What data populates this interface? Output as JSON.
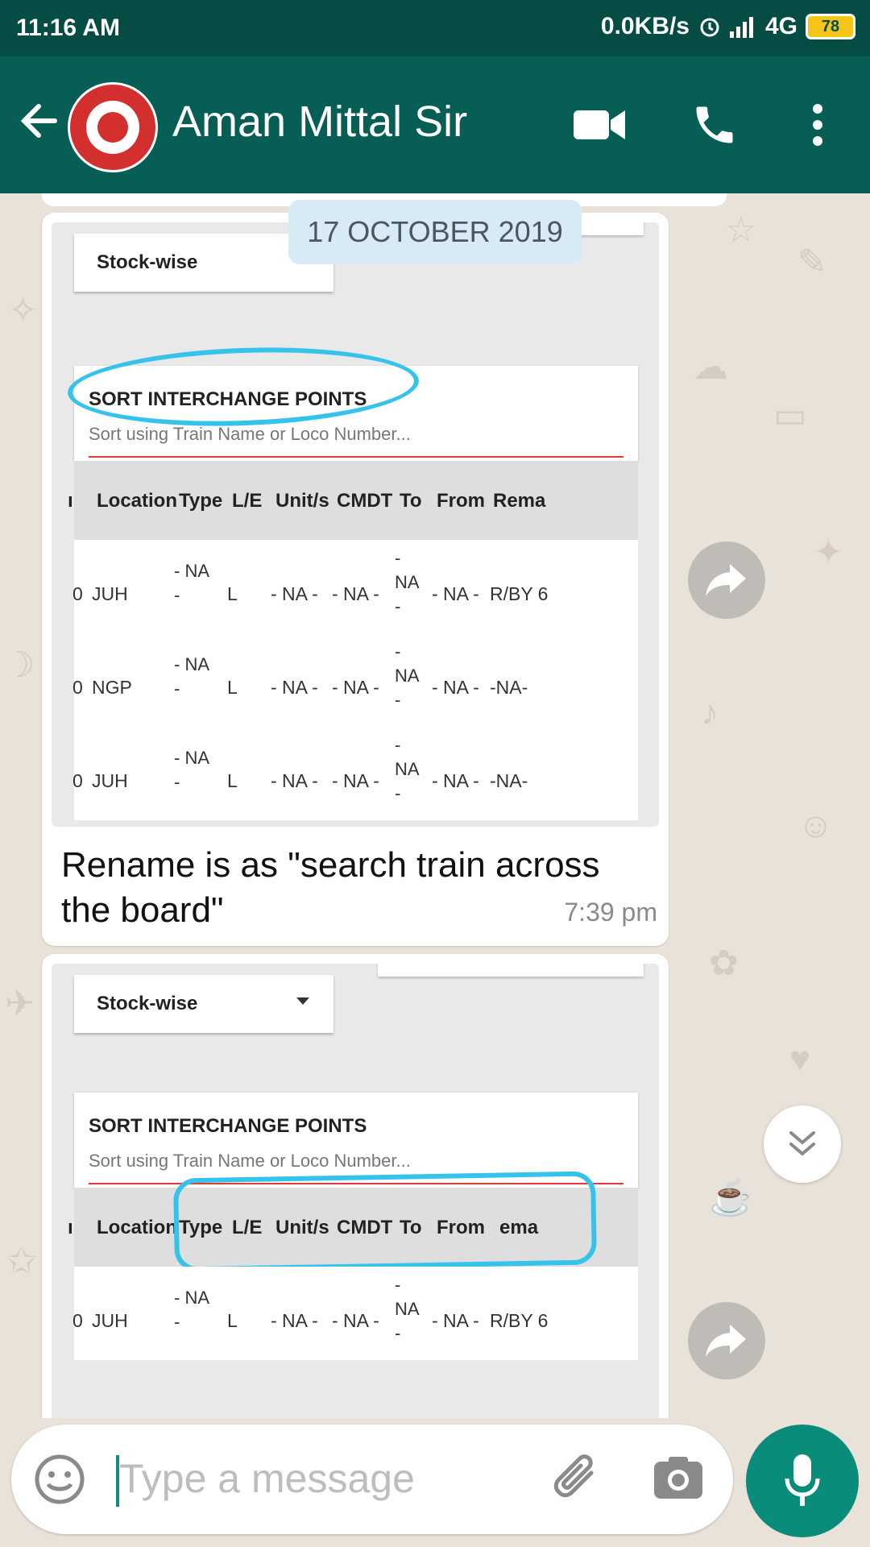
{
  "status_bar": {
    "time": "11:16 AM",
    "net_speed": "0.0KB/s",
    "network": "4G",
    "battery": "78"
  },
  "app_bar": {
    "contact_name": "Aman Mittal Sir"
  },
  "date_chip": "17 OCTOBER 2019",
  "screenshot_content": {
    "dropdown": "Stock-wise",
    "card_heading": "SORT INTERCHANGE POINTS",
    "search_placeholder": "Sort using Train Name or Loco Number...",
    "columns": [
      "Location",
      "Type",
      "L/E",
      "Unit/s",
      "CMDT",
      "To",
      "From",
      "Rema"
    ],
    "rows": [
      {
        "prefix": "0",
        "location": "JUH",
        "type": "- NA -",
        "le": "L",
        "units": "- NA -",
        "cmdt": "- NA -",
        "to": "- NA -",
        "from": "- NA -",
        "remarks": "R/BY 6"
      },
      {
        "prefix": "0",
        "location": "NGP",
        "type": "- NA -",
        "le": "L",
        "units": "- NA -",
        "cmdt": "- NA -",
        "to": "- NA -",
        "from": "- NA -",
        "remarks": "-NA-"
      },
      {
        "prefix": "0",
        "location": "JUH",
        "type": "- NA -",
        "le": "L",
        "units": "- NA -",
        "cmdt": "- NA -",
        "to": "- NA -",
        "from": "- NA -",
        "remarks": "-NA-"
      }
    ]
  },
  "messages": [
    {
      "text": "Rename is as \"search train across the board\"",
      "time": "7:39 pm"
    }
  ],
  "second_screenshot": {
    "remarks_header": "ema"
  },
  "input": {
    "placeholder": "Type a message"
  },
  "colors": {
    "header": "#075e54",
    "status_bar": "#054d44",
    "accent": "#0a8c7a",
    "highlight": "#35c3ec"
  }
}
